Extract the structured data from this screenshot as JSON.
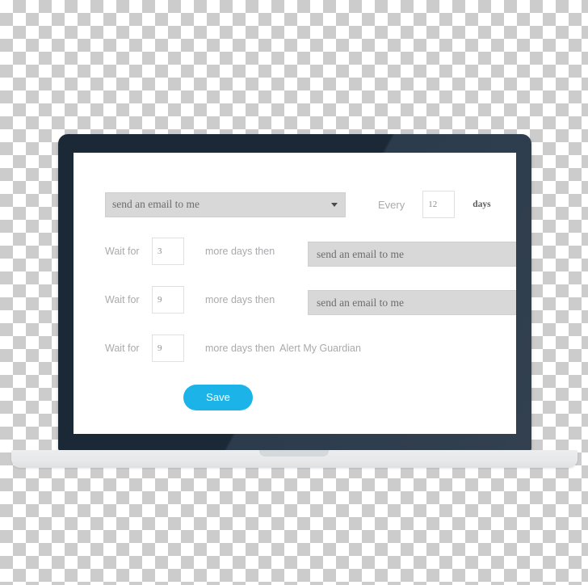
{
  "device": {
    "type": "laptop-mockup",
    "bezel_color": "#1b2836",
    "base_color": "#e8e9ea",
    "screen_background": "#ffffff"
  },
  "theme": {
    "accent": "#1cb4e8",
    "select_fill": "#d8d8d8",
    "select_border": "#cfcfcf",
    "label_gray": "#a9aaac",
    "value_gray": "#6d6d6d",
    "input_border": "#e0e0e0"
  },
  "form": {
    "action_select": {
      "value": "send an email to me",
      "caret": "chevron-down-icon"
    },
    "every": {
      "prefix_label": "Every",
      "value": "12",
      "unit_label": "days"
    },
    "steps": [
      {
        "wait_label": "Wait for",
        "days_value": "3",
        "then_label": "more days then",
        "action_value": "send an email to me",
        "has_select": true
      },
      {
        "wait_label": "Wait for",
        "days_value": "9",
        "then_label": "more days then",
        "action_value": "send an email to me",
        "has_select": true
      },
      {
        "wait_label": "Wait for",
        "days_value": "9",
        "then_label": "more days then",
        "action_value": "Alert My Guardian",
        "has_select": false
      }
    ],
    "save_label": "Save"
  }
}
